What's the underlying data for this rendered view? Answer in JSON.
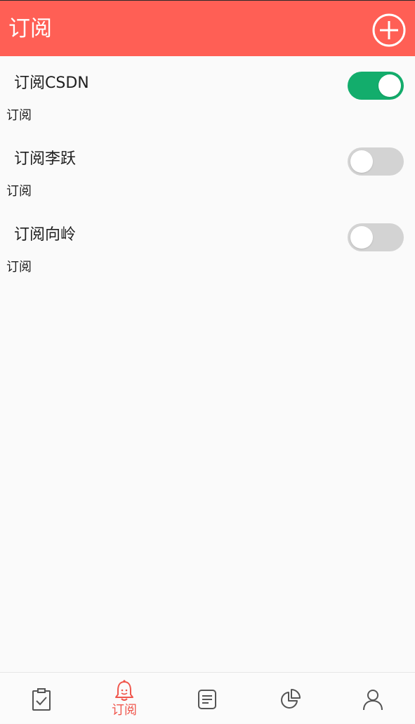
{
  "header": {
    "title": "订阅",
    "add_icon": "plus-circle-icon"
  },
  "subscriptions": [
    {
      "name": "订阅CSDN",
      "sub": "订阅",
      "enabled": true
    },
    {
      "name": "订阅李跃",
      "sub": "订阅",
      "enabled": false
    },
    {
      "name": "订阅向岭",
      "sub": "订阅",
      "enabled": false
    }
  ],
  "bottom_nav": {
    "tabs": [
      {
        "icon": "clipboard-check-icon",
        "label": ""
      },
      {
        "icon": "bell-icon",
        "label": "订阅",
        "active": true
      },
      {
        "icon": "document-list-icon",
        "label": ""
      },
      {
        "icon": "pie-chart-icon",
        "label": ""
      },
      {
        "icon": "user-icon",
        "label": ""
      }
    ]
  },
  "colors": {
    "header_bg": "#ff5f55",
    "switch_on": "#13ad6c",
    "switch_off": "#d3d3d3",
    "active_tab": "#f0564c",
    "inactive_icon": "#555555"
  }
}
